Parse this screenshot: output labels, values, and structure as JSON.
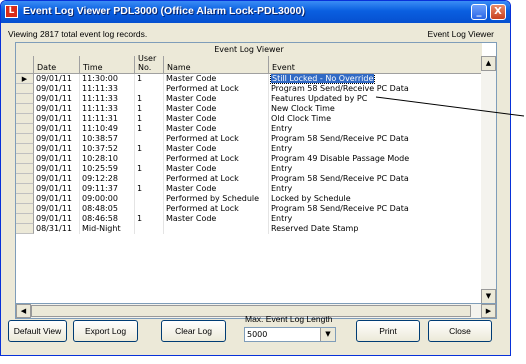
{
  "window": {
    "title": "Event Log Viewer PDL3000 (Office Alarm Lock-PDL3000)",
    "min_glyph": "_",
    "close_glyph": "X",
    "icon_glyph": "L"
  },
  "summary": "Viewing 2817 total event log records.",
  "viewer_label": "Event Log Viewer",
  "grid": {
    "caption": "Event Log Viewer",
    "columns": [
      "Date",
      "Time",
      "User No.",
      "Name",
      "Event"
    ],
    "selected_row": 0,
    "rows": [
      [
        "09/01/11",
        "11:30:00",
        "1",
        "Master Code",
        "Still Locked - No Override"
      ],
      [
        "09/01/11",
        "11:11:33",
        "",
        "Performed at Lock",
        "Program 58 Send/Receive PC Data"
      ],
      [
        "09/01/11",
        "11:11:33",
        "1",
        "Master Code",
        "Features Updated by PC"
      ],
      [
        "09/01/11",
        "11:11:33",
        "1",
        "Master Code",
        "New Clock Time"
      ],
      [
        "09/01/11",
        "11:11:31",
        "1",
        "Master Code",
        "Old Clock Time"
      ],
      [
        "09/01/11",
        "11:10:49",
        "1",
        "Master Code",
        "Entry"
      ],
      [
        "09/01/11",
        "10:38:57",
        "",
        "Performed at Lock",
        "Program 58 Send/Receive PC Data"
      ],
      [
        "09/01/11",
        "10:37:52",
        "1",
        "Master Code",
        "Entry"
      ],
      [
        "09/01/11",
        "10:28:10",
        "",
        "Performed at Lock",
        "Program 49 Disable Passage Mode"
      ],
      [
        "09/01/11",
        "10:25:59",
        "1",
        "Master Code",
        "Entry"
      ],
      [
        "09/01/11",
        "09:12:28",
        "",
        "Performed at Lock",
        "Program 58 Send/Receive PC Data"
      ],
      [
        "09/01/11",
        "09:11:37",
        "1",
        "Master Code",
        "Entry"
      ],
      [
        "09/01/11",
        "09:00:00",
        "",
        "Performed by Schedule",
        "Locked by Schedule"
      ],
      [
        "09/01/11",
        "08:48:05",
        "",
        "Performed at Lock",
        "Program 58 Send/Receive PC Data"
      ],
      [
        "09/01/11",
        "08:46:58",
        "1",
        "Master Code",
        "Entry"
      ],
      [
        "08/31/11",
        "Mid-Night",
        "",
        "",
        "Reserved Date Stamp"
      ]
    ]
  },
  "buttons": {
    "default_view": "Default View",
    "export_log": "Export Log",
    "clear_log": "Clear Log",
    "print": "Print",
    "close": "Close"
  },
  "max_length": {
    "label": "Max. Event Log Length",
    "value": "5000"
  },
  "icons": {
    "row_pointer": "▶",
    "scroll_up": "▲",
    "scroll_down": "▼",
    "scroll_left": "◀",
    "scroll_right": "▶",
    "dropdown": "▼"
  },
  "colors": {
    "titlebar": "#0a5fe0",
    "selection": "#316ac5",
    "window_bg": "#ece9d8"
  }
}
